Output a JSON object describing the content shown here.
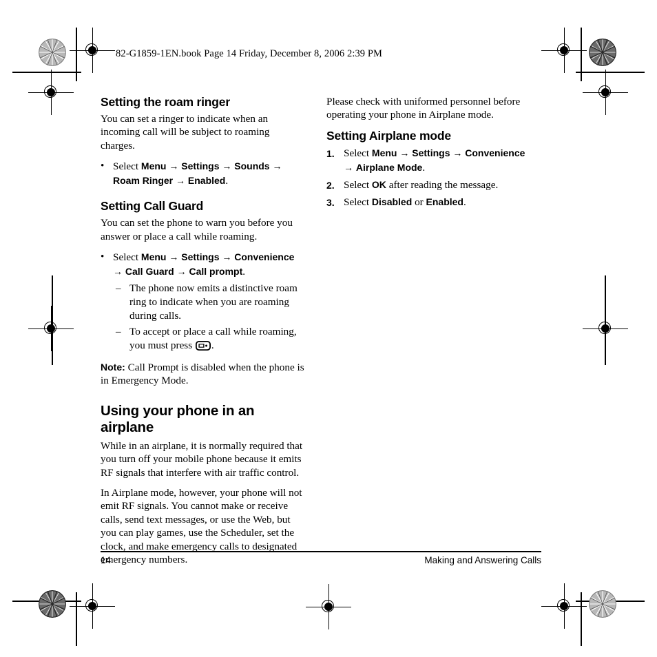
{
  "page": {
    "book_header": "82-G1859-1EN.book  Page 14  Friday, December 8, 2006  2:39 PM",
    "arrow": "→",
    "bullet": "•",
    "dash": "–"
  },
  "left_column": {
    "sections": [
      {
        "heading": "Setting the roam ringer",
        "paragraph": "You can set a ringer to indicate when an incoming call will be subject to roaming charges.",
        "bullet": {
          "lead": "Select ",
          "steps": [
            "Menu",
            "Settings",
            "Sounds",
            "Roam Ringer",
            "Enabled"
          ],
          "trailing": "."
        }
      },
      {
        "heading": "Setting Call Guard",
        "paragraph": "You can set the phone to warn you before you answer or place a call while roaming.",
        "bullet": {
          "lead": "Select ",
          "steps": [
            "Menu",
            "Settings",
            "Convenience",
            "Call Guard",
            "Call prompt"
          ],
          "trailing": "."
        },
        "sub_items": [
          "The phone now emits a distinctive roam ring to indicate when you are roaming during calls.",
          "To accept or place a call while roaming, you must press"
        ],
        "sub_item_icon": "send-key-icon",
        "sub_item_icon_trailing": "."
      }
    ],
    "note": {
      "label": "Note:",
      "text": " Call Prompt is disabled when the phone is in Emergency Mode."
    },
    "main_heading": "Using your phone in an airplane",
    "paragraphs": [
      "While in an airplane, it is normally required that you turn off your mobile phone because it emits RF signals that interfere with air traffic control.",
      "In Airplane mode, however, your phone will not emit RF signals. You cannot make or receive calls, send text messages, or use the Web, but you can play games, use the Scheduler, set the clock, and make emergency calls to designated emergency numbers."
    ]
  },
  "right_column": {
    "intro_paragraph": "Please check with uniformed personnel before operating your phone in Airplane mode.",
    "heading": "Setting Airplane mode",
    "steps": [
      {
        "number": "1.",
        "lead": "Select ",
        "ui_steps": [
          "Menu",
          "Settings",
          "Convenience",
          "Airplane Mode"
        ],
        "trailing": "."
      },
      {
        "number": "2.",
        "lead": "Select ",
        "ui_steps": [
          "OK"
        ],
        "trailing": " after reading the message."
      },
      {
        "number": "3.",
        "lead": "Select ",
        "ui_steps": [
          "Disabled",
          "Enabled"
        ],
        "joiner": " or ",
        "trailing": "."
      }
    ]
  },
  "footer": {
    "page_number": "14",
    "section_title": "Making and Answering Calls"
  },
  "colors": {
    "ink": "#000000",
    "paper": "#ffffff"
  }
}
